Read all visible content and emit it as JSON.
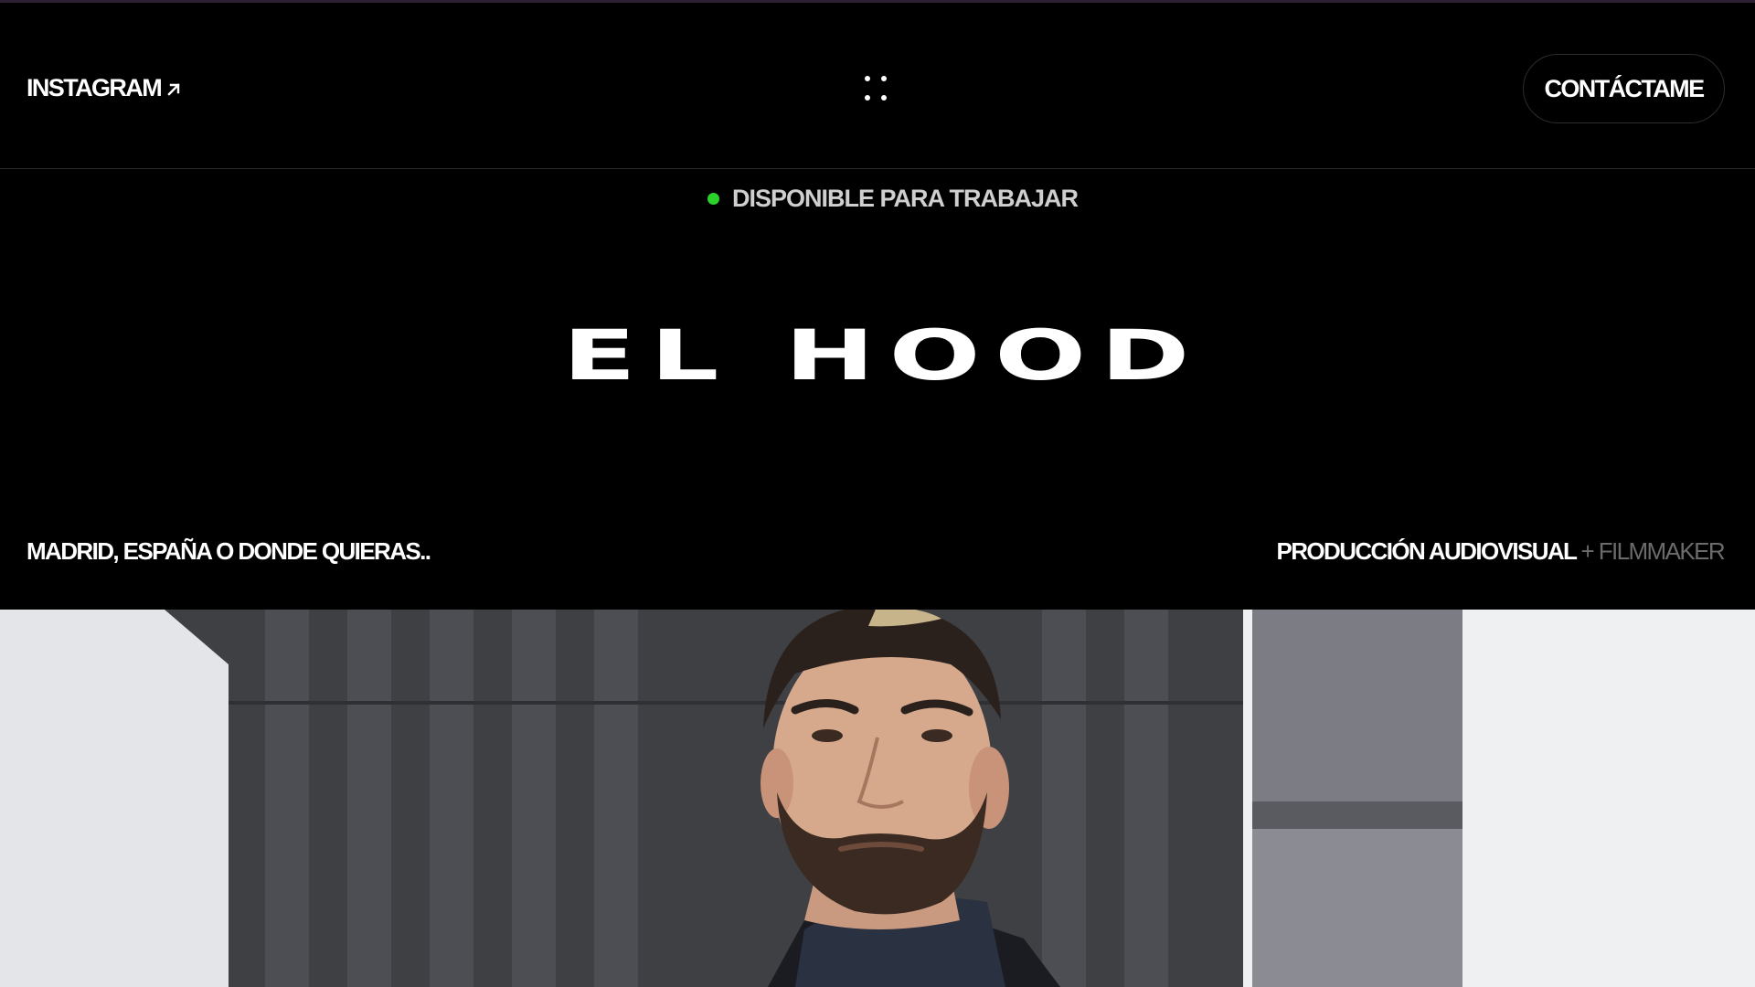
{
  "header": {
    "instagram_label": "INSTAGRAM",
    "contact_label": "CONTÁCTAME"
  },
  "hero": {
    "status_text": "DISPONIBLE PARA TRABAJAR",
    "status_color": "#2ad22a",
    "title": "EL HOOD",
    "location": "MADRID, ESPAÑA O DONDE QUIERAS..",
    "role_primary": "PRODUCCIÓN AUDIOVISUAL",
    "role_secondary": "+ FILMMAKER"
  },
  "icons": {
    "instagram_arrow": "arrow-up-right-icon",
    "menu": "menu-dots-icon"
  },
  "colors": {
    "background": "#000000",
    "text": "#ffffff",
    "muted": "#6b6b6b"
  }
}
